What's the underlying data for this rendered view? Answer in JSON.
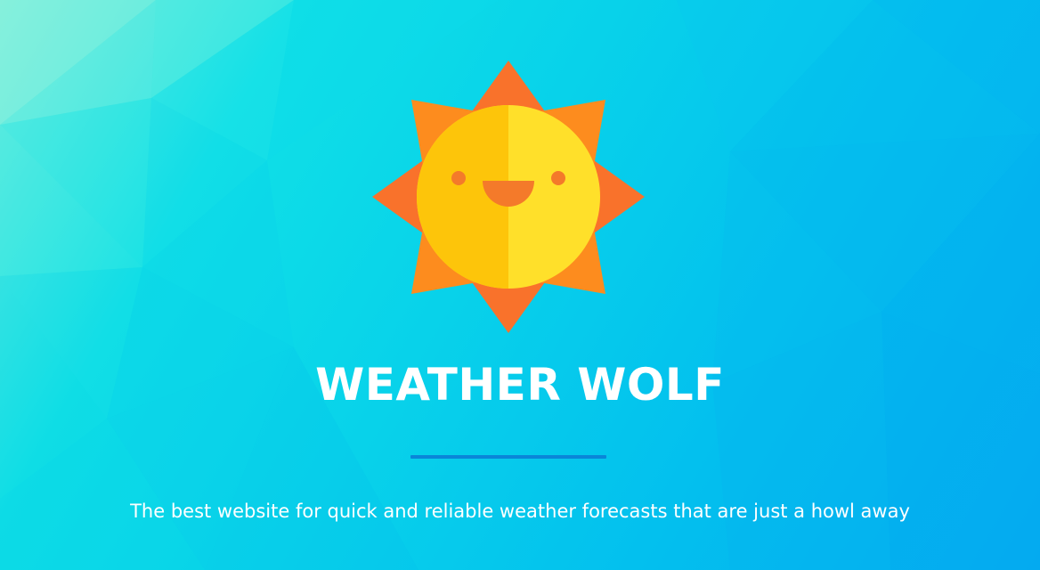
{
  "hero": {
    "title": "WEATHER WOLF",
    "tagline": "The best website for quick and reliable weather forecasts that are just a howl away"
  },
  "logo": {
    "icon": "smiling-sun-icon"
  },
  "colors": {
    "background_start": "#7ff0dc",
    "background_end": "#05abf0",
    "sun_rays_dark": "#f9722b",
    "sun_rays_light": "#fd8c1e",
    "sun_face_left": "#fdc50a",
    "sun_face_right": "#ffe02a",
    "sun_features": "#f47a2a",
    "divider": "#0a86d8",
    "text": "#ffffff"
  }
}
